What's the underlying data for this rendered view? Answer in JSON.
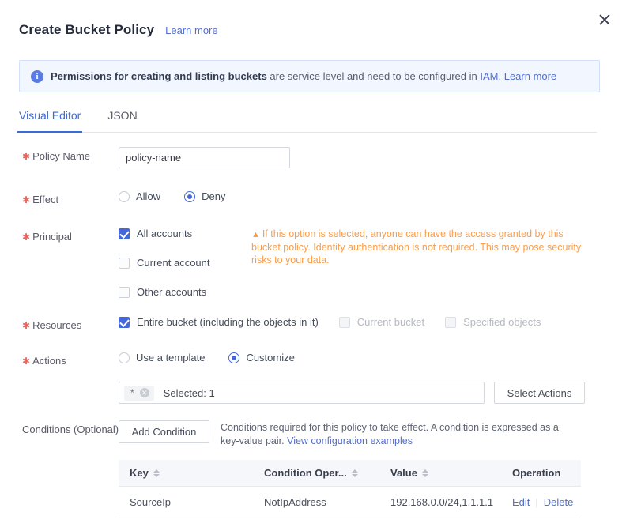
{
  "header": {
    "title": "Create Bucket Policy",
    "learn_more": "Learn more",
    "close_icon": "close-icon"
  },
  "banner": {
    "icon": "info-icon",
    "strong": "Permissions for creating and listing buckets",
    "rest": " are service level and need to be configured in ",
    "link1": "IAM.",
    "link2": "Learn more"
  },
  "tabs": [
    {
      "label": "Visual Editor",
      "active": true
    },
    {
      "label": "JSON",
      "active": false
    }
  ],
  "form": {
    "policy_name": {
      "label": "Policy Name",
      "required": true,
      "value": "policy-name",
      "placeholder": "policy-name"
    },
    "effect": {
      "label": "Effect",
      "required": true,
      "options": [
        {
          "label": "Allow",
          "selected": false
        },
        {
          "label": "Deny",
          "selected": true
        }
      ]
    },
    "principal": {
      "label": "Principal",
      "required": true,
      "options": [
        {
          "label": "All accounts",
          "checked": true,
          "disabled": false
        },
        {
          "label": "Current account",
          "checked": false,
          "disabled": false
        },
        {
          "label": "Other accounts",
          "checked": false,
          "disabled": false
        }
      ],
      "warning_icon": "warning-triangle-icon",
      "warning": "If this option is selected, anyone can have the access granted by this bucket policy. Identity authentication is not required. This may pose security risks to your data."
    },
    "resources": {
      "label": "Resources",
      "required": true,
      "options": [
        {
          "label": "Entire bucket (including the objects in it)",
          "checked": true,
          "disabled": false
        },
        {
          "label": "Current bucket",
          "checked": false,
          "disabled": true
        },
        {
          "label": "Specified objects",
          "checked": false,
          "disabled": true
        }
      ]
    },
    "actions": {
      "label": "Actions",
      "required": true,
      "options": [
        {
          "label": "Use a template",
          "selected": false
        },
        {
          "label": "Customize",
          "selected": true
        }
      ],
      "chip_label": "*",
      "chip_close_icon": "chip-close-icon",
      "selected_text": "Selected: 1",
      "select_button": "Select Actions"
    },
    "conditions": {
      "label": "Conditions (Optional)",
      "add_button": "Add Condition",
      "description": "Conditions required for this policy to take effect. A condition is expressed as a key-value pair. ",
      "description_link": "View configuration examples",
      "table": {
        "columns": [
          {
            "label": "Key",
            "sortable": true
          },
          {
            "label": "Condition Oper...",
            "sortable": true
          },
          {
            "label": "Value",
            "sortable": true
          },
          {
            "label": "Operation",
            "sortable": false
          }
        ],
        "rows": [
          {
            "key": "SourceIp",
            "operator": "NotIpAddress",
            "value": "192.168.0.0/24,1.1.1.1",
            "edit": "Edit",
            "delete": "Delete"
          }
        ]
      }
    }
  },
  "colors": {
    "accent": "#4468d8",
    "link": "#526ecc",
    "required_star": "#e8675f",
    "warning": "#fa9d4b",
    "banner_bg": "#f2f6ff",
    "banner_border": "#d3e0fb",
    "table_header_bg": "#f5f7fa"
  }
}
